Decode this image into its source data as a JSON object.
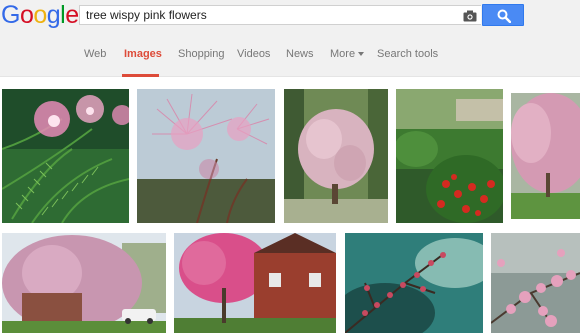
{
  "logo": {
    "text": "Google",
    "letters": [
      "G",
      "o",
      "o",
      "g",
      "l",
      "e"
    ],
    "colors": [
      "#3369e8",
      "#d50f25",
      "#eeb211",
      "#3369e8",
      "#009925",
      "#d50f25"
    ]
  },
  "search": {
    "query": "tree wispy pink flowers",
    "camera_icon": "camera-icon",
    "button_icon": "magnifier-icon"
  },
  "tabs": [
    {
      "label": "Web",
      "active": false
    },
    {
      "label": "Images",
      "active": true
    },
    {
      "label": "Shopping",
      "active": false
    },
    {
      "label": "Videos",
      "active": false
    },
    {
      "label": "News",
      "active": false
    },
    {
      "label": "More",
      "active": false
    },
    {
      "label": "Search tools",
      "active": false
    }
  ],
  "colors": {
    "accent": "#dd4b39",
    "search_button": "#4a8af4",
    "tab_text": "#777777",
    "header_bg": "#f1f1f1"
  },
  "images": [
    {
      "subject": "mimosa-tree-flowers-closeup"
    },
    {
      "subject": "mimosa-flower-against-sky"
    },
    {
      "subject": "pink-flowering-tree-in-woods"
    },
    {
      "subject": "garden-with-red-flowers"
    },
    {
      "subject": "pink-tree-over-lawn"
    },
    {
      "subject": "weeping-cherry-tree-by-house"
    },
    {
      "subject": "redbud-tree-by-brick-house"
    },
    {
      "subject": "pink-blossom-branch-teal-sky"
    },
    {
      "subject": "pink-blossoms-closeup"
    }
  ]
}
